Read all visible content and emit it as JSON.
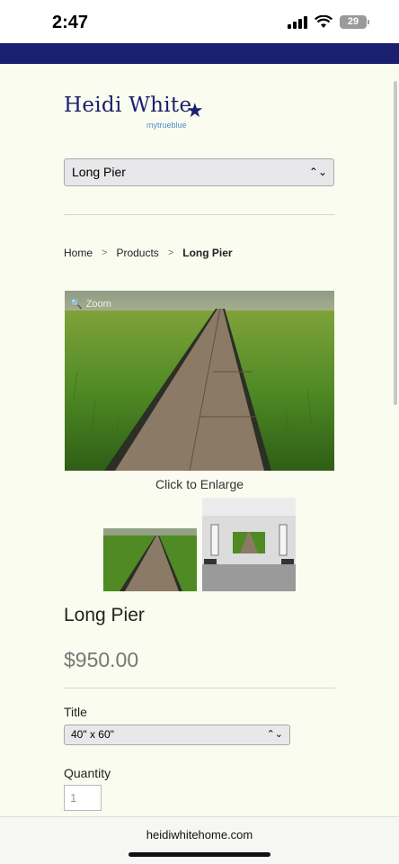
{
  "status_bar": {
    "time": "2:47",
    "battery": "29"
  },
  "logo": {
    "name": "Heidi White",
    "tagline": "mytrueblue"
  },
  "nav": {
    "selected": "Long Pier"
  },
  "breadcrumb": {
    "home": "Home",
    "sep1": ">",
    "products": "Products",
    "sep2": ">",
    "current": "Long Pier"
  },
  "product": {
    "zoom_label": "Zoom",
    "enlarge_text": "Click to Enlarge",
    "title": "Long Pier",
    "price": "$950.00"
  },
  "options": {
    "title_label": "Title",
    "title_value": "40\" x 60\"",
    "quantity_label": "Quantity",
    "quantity_value": "1"
  },
  "browser": {
    "url": "heidiwhitehome.com"
  },
  "colors": {
    "brand_navy": "#1a1f6f",
    "background": "#fbfcf0",
    "price_gray": "#777777"
  }
}
